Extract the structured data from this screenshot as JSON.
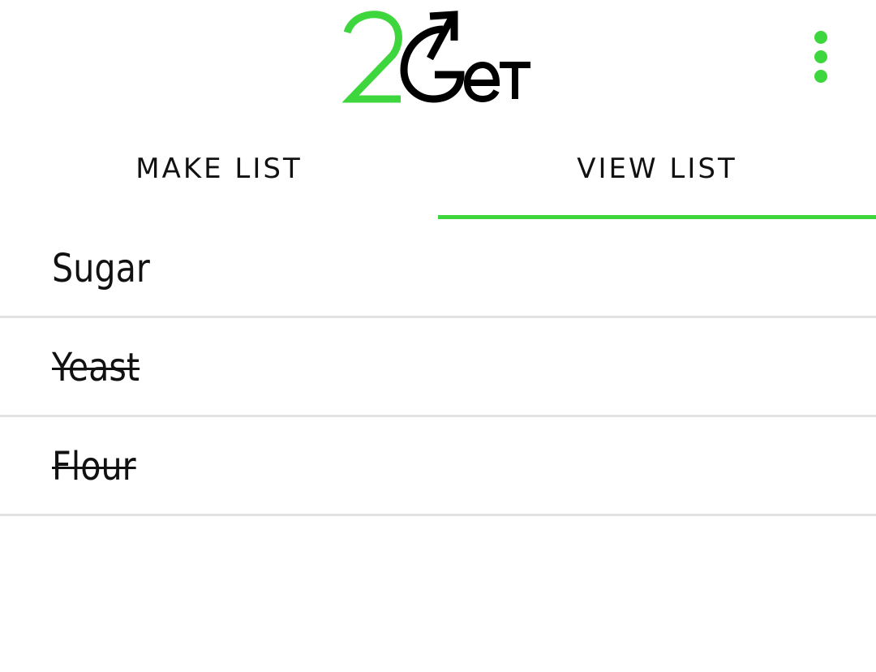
{
  "app": {
    "logo_text": "2GeT",
    "accent_color": "#3dd63d",
    "text_color": "#111111"
  },
  "header": {
    "menu_icon": "more-vert-icon"
  },
  "tabs": [
    {
      "label": "MAKE LIST",
      "selected": false
    },
    {
      "label": "VIEW LIST",
      "selected": true
    }
  ],
  "list": {
    "items": [
      {
        "label": "Sugar",
        "checked": false
      },
      {
        "label": "Yeast",
        "checked": true
      },
      {
        "label": "Flour",
        "checked": true
      }
    ]
  }
}
